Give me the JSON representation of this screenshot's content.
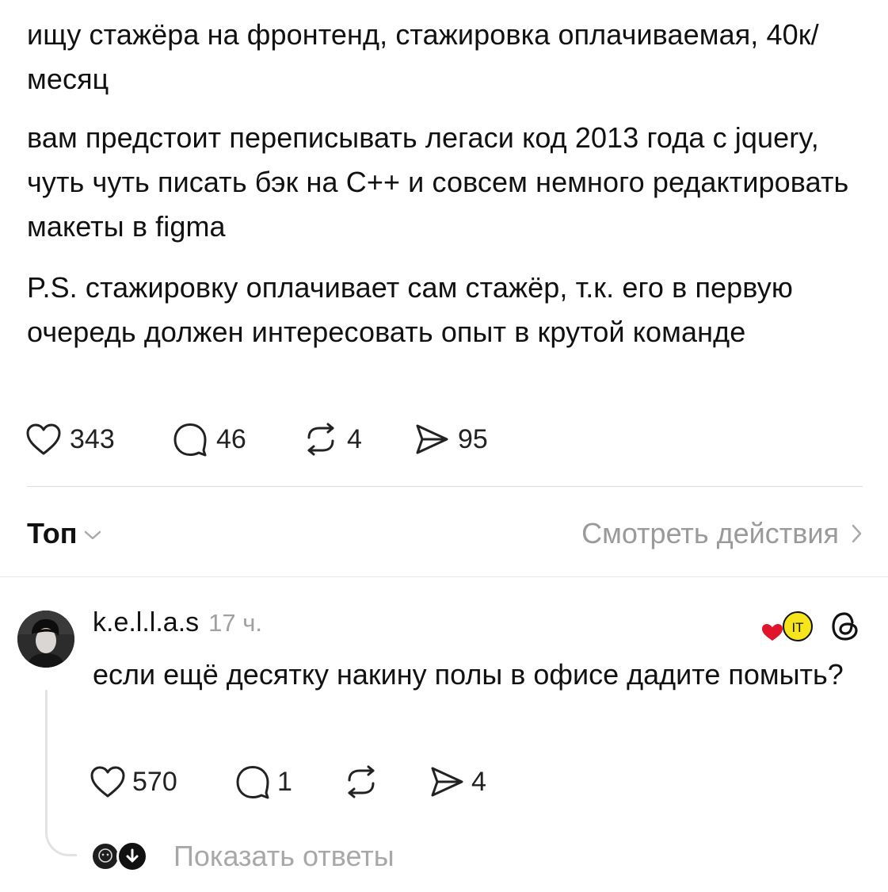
{
  "post": {
    "paragraphs": [
      "ищу стажёра на фронтенд, стажировка оплачиваемая, 40к/месяц",
      "вам предстоит переписывать легаси код 2013 года с jquery, чуть чуть писать бэк на C++ и совсем немного редактировать макеты в figma",
      "P.S. стажировку оплачивает сам стажёр, т.к. его в первую очередь должен интересовать опыт в крутой команде"
    ],
    "stats": {
      "likes": "343",
      "comments": "46",
      "reposts": "4",
      "shares": "95"
    }
  },
  "sort_bar": {
    "sort_label": "Топ",
    "activity_label": "Смотреть действия"
  },
  "comment": {
    "username": "k.e.l.l.a.s",
    "time": "17 ч.",
    "badge_text": "IT",
    "text": "если ещё десятку накину полы в офисе дадите помыть?",
    "stats": {
      "likes": "570",
      "comments": "1",
      "reposts": "",
      "shares": "4"
    },
    "show_replies_label": "Показать ответы"
  },
  "icons": {
    "like": "heart-icon",
    "comment": "comment-bubble-icon",
    "repost": "repost-icon",
    "share": "share-send-icon",
    "sort": "chevron-down-icon",
    "activity": "chevron-right-icon",
    "threads": "threads-logo-icon",
    "badge": "heart-it-badge-icon",
    "replies": "arrow-down-circle-icon"
  },
  "colors": {
    "text": "#111111",
    "muted": "#9a9a9a",
    "heart_red": "#e0142b",
    "badge_yellow": "#f5e51a"
  }
}
